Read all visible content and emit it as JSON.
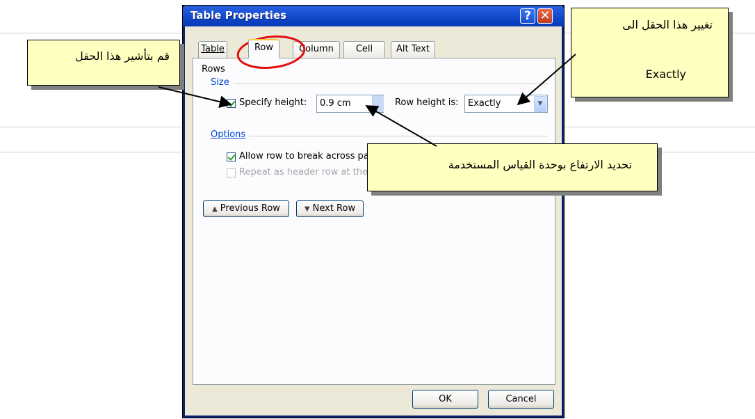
{
  "dialog": {
    "title": "Table Properties",
    "help_glyph": "?",
    "close_glyph": "✕",
    "tabs": [
      {
        "label": "Table"
      },
      {
        "label": "Row"
      },
      {
        "label": "Column"
      },
      {
        "label": "Cell"
      },
      {
        "label": "Alt Text"
      }
    ],
    "active_tab": "Row",
    "rows_label": "Rows",
    "size_group": "Size",
    "specify_height_label": "Specify height:",
    "specify_height_checked": true,
    "height_value": "0.9 cm",
    "row_height_is_label": "Row height is:",
    "row_height_is_value": "Exactly",
    "options_group": "Options",
    "allow_break_label": "Allow row to break across pa",
    "allow_break_checked": true,
    "repeat_header_label": "Repeat as header row at the",
    "repeat_header_checked": false,
    "previous_row_label": "Previous Row",
    "next_row_label": "Next Row",
    "ok_label": "OK",
    "cancel_label": "Cancel"
  },
  "callouts": {
    "change_field_line1": "تغيير هذا الحقل الى",
    "change_field_line2": "Exactly",
    "check_field": "قم بتأشير هذا الحقل",
    "set_height": "تحديد الارتفاع بوحدة القياس المستخدمة"
  },
  "colors": {
    "titlebar": "#0d43c4",
    "callout_fill": "#ffffc0",
    "highlight_ellipse": "#e01010",
    "group_label": "#0046d5"
  }
}
